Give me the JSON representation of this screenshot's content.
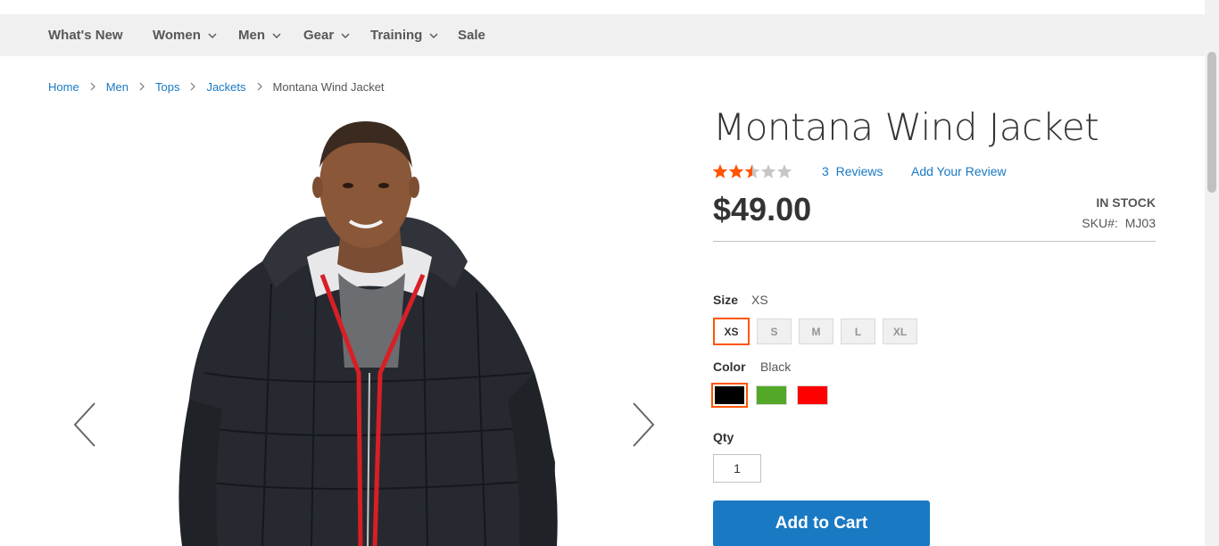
{
  "nav": {
    "items": [
      {
        "label": "What's New",
        "has_dropdown": false
      },
      {
        "label": "Women",
        "has_dropdown": true
      },
      {
        "label": "Men",
        "has_dropdown": true
      },
      {
        "label": "Gear",
        "has_dropdown": true
      },
      {
        "label": "Training",
        "has_dropdown": true
      },
      {
        "label": "Sale",
        "has_dropdown": false
      }
    ]
  },
  "breadcrumb": {
    "items": [
      "Home",
      "Men",
      "Tops",
      "Jackets"
    ],
    "current": "Montana Wind Jacket"
  },
  "product": {
    "name": "Montana Wind Jacket",
    "rating_stars": 2.5,
    "rating_max": 5,
    "reviews_count": "3",
    "reviews_label": "Reviews",
    "add_review_label": "Add Your Review",
    "price": "$49.00",
    "stock_status": "In stock",
    "sku_label": "SKU#:",
    "sku": "MJ03"
  },
  "options": {
    "size": {
      "label": "Size",
      "selected": "XS",
      "values": [
        "XS",
        "S",
        "M",
        "L",
        "XL"
      ]
    },
    "color": {
      "label": "Color",
      "selected": "Black",
      "swatches": [
        {
          "name": "Black",
          "hex": "#000000"
        },
        {
          "name": "Green",
          "hex": "#53a828"
        },
        {
          "name": "Red",
          "hex": "#ff0000"
        }
      ]
    }
  },
  "qty": {
    "label": "Qty",
    "value": "1"
  },
  "cart": {
    "button_label": "Add to Cart"
  },
  "colors": {
    "accent": "#1979c3",
    "star": "#ff5501",
    "selected_outline": "#ff5501",
    "nav_bg": "#f0f0f0"
  }
}
